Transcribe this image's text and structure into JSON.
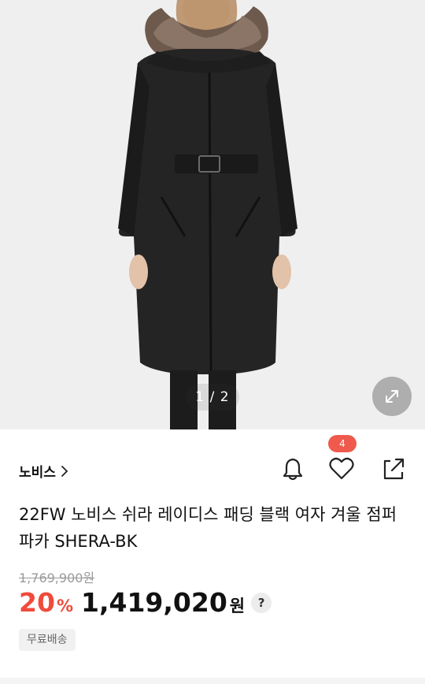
{
  "image": {
    "pager": "1 / 2",
    "alt": "노비스 쉬라 레이디스 패딩"
  },
  "brand": {
    "name": "노비스",
    "chevron": "chevron-right-icon"
  },
  "actions": {
    "like_count": "4",
    "icons": [
      "bell-icon",
      "heart-icon",
      "share-icon"
    ]
  },
  "product": {
    "title": "22FW 노비스 쉬라 레이디스 패딩 블랙 여자 겨울 점퍼 파카 SHERA-BK"
  },
  "price": {
    "original": "1,769,900원",
    "discount": "20",
    "discount_unit": "%",
    "final": "1,419,020",
    "currency": "원",
    "help": "?"
  },
  "shipping": {
    "label": "무료배송"
  },
  "colors": {
    "discount": "#ef4b3c",
    "badge": "#ef5a4d"
  }
}
